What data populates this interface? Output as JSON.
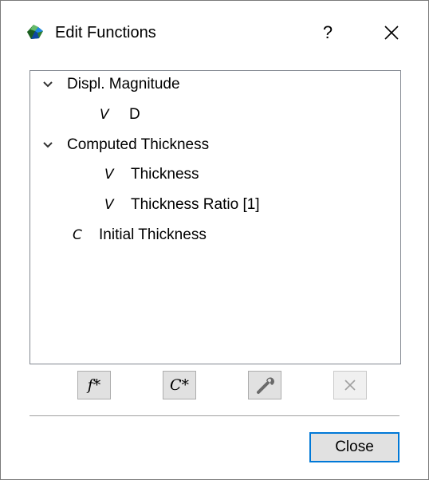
{
  "dialog": {
    "title": "Edit Functions",
    "help_label": "?"
  },
  "tree": {
    "items": [
      {
        "label": "Displ. Magnitude",
        "expanded": true
      },
      {
        "type": "V",
        "label": "D"
      },
      {
        "label": "Computed Thickness",
        "expanded": true
      },
      {
        "type": "V",
        "label": "Thickness"
      },
      {
        "type": "V",
        "label": "Thickness Ratio [1]"
      },
      {
        "type": "C",
        "label": "Initial Thickness"
      }
    ]
  },
  "toolbar": {
    "new_function_label": "f*",
    "new_constant_label": "C*",
    "edit_icon": "wrench-icon",
    "delete_icon": "delete-x-icon"
  },
  "footer": {
    "close_label": "Close"
  },
  "colors": {
    "focus_border": "#0078d7",
    "button_face": "#e1e1e1",
    "tree_border": "#828790"
  }
}
